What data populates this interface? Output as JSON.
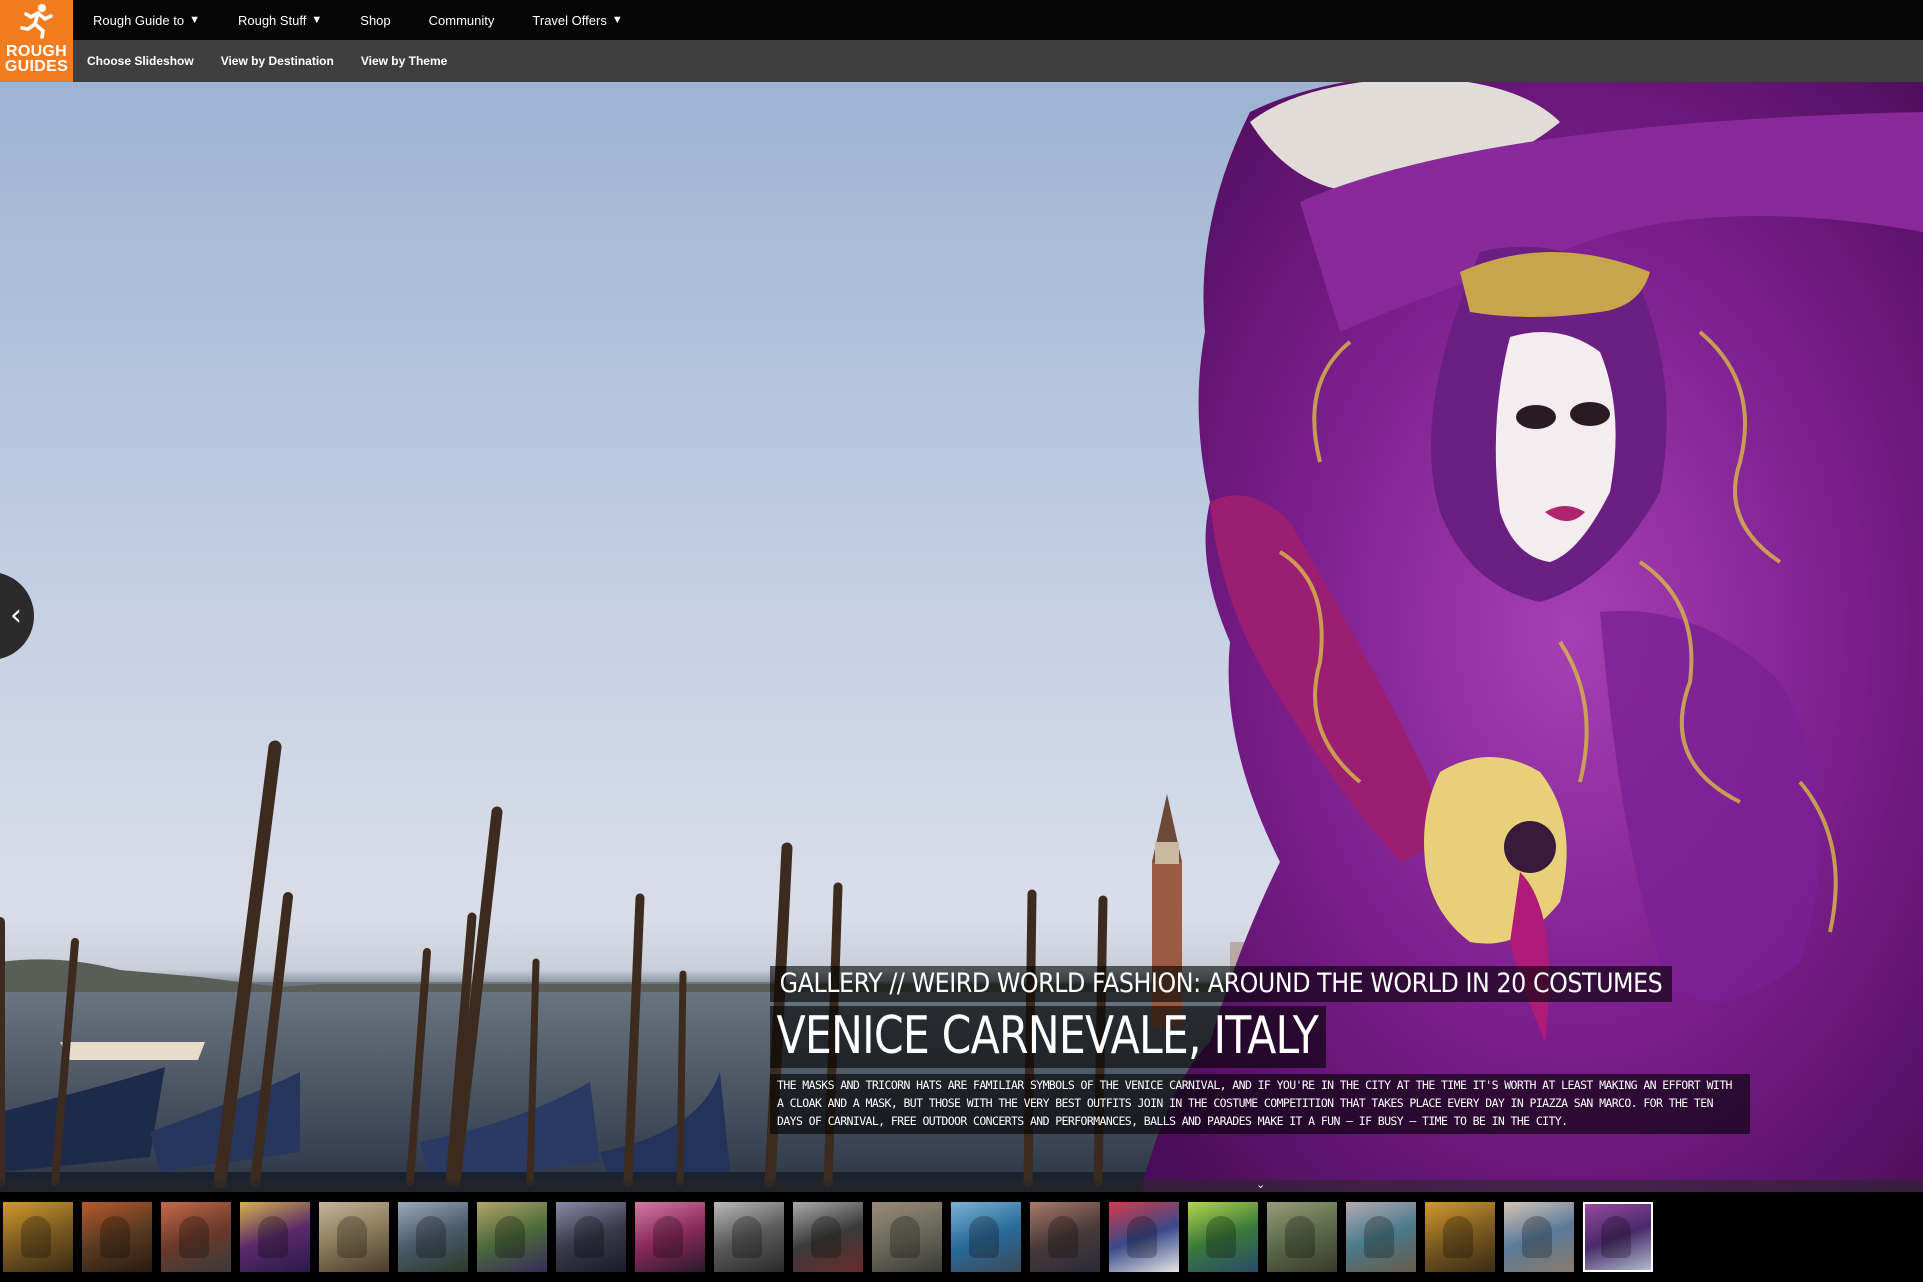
{
  "logo": {
    "line1": "ROUGH",
    "line2": "GUIDES",
    "brand_color": "#f47c20",
    "icon": "running-figure-icon"
  },
  "topnav": {
    "items": [
      {
        "label": "Rough Guide to",
        "has_dropdown": true
      },
      {
        "label": "Rough Stuff",
        "has_dropdown": true
      },
      {
        "label": "Shop",
        "has_dropdown": false
      },
      {
        "label": "Community",
        "has_dropdown": false
      },
      {
        "label": "Travel Offers",
        "has_dropdown": true
      }
    ],
    "caret": "▼"
  },
  "subnav": {
    "items": [
      {
        "label": "Choose Slideshow"
      },
      {
        "label": "View by Destination"
      },
      {
        "label": "View by Theme"
      }
    ]
  },
  "slideshow": {
    "prev_arrow": "‹",
    "gallery_title": "GALLERY // WEIRD WORLD FASHION: AROUND THE WORLD IN 20 COSTUMES",
    "slide_title": "VENICE CARNEVALE, ITALY",
    "description": "The masks and tricorn hats are familiar symbols of the Venice Carnival, and if you're in the city at the time it's worth at least making an effort with a cloak and a mask, but those with the very best outfits join in the costume competition that takes place every day in Piazza San Marco. For the ten days of carnival, free outdoor concerts and performances, balls and parades make it a fun – if busy – time to be in the city.",
    "expand_icon": "⌄"
  },
  "thumbnails": [
    {
      "colors": [
        "#7a5a22",
        "#d39a2a",
        "#3b2a14"
      ]
    },
    {
      "colors": [
        "#5a3b22",
        "#b85a2a",
        "#2a1a10"
      ]
    },
    {
      "colors": [
        "#6a3a2a",
        "#c76a4a",
        "#3a3a3a"
      ]
    },
    {
      "colors": [
        "#5a2a6a",
        "#d4b24a",
        "#2a1a4a"
      ]
    },
    {
      "colors": [
        "#8a7a5a",
        "#c4b49a",
        "#4a3a2a"
      ]
    },
    {
      "colors": [
        "#4a5a6a",
        "#9aaaba",
        "#2a3a2a"
      ]
    },
    {
      "colors": [
        "#4a6a3a",
        "#b4a46a",
        "#3a2a5a"
      ]
    },
    {
      "colors": [
        "#3a3a4a",
        "#8a8aaa",
        "#1a1a2a"
      ]
    },
    {
      "colors": [
        "#8a2a5a",
        "#d47aa4",
        "#2a1a2a"
      ]
    },
    {
      "colors": [
        "#5a5a5a",
        "#bababa",
        "#2a2a2a"
      ]
    },
    {
      "colors": [
        "#3a3a3a",
        "#aaaaaa",
        "#6a2a2a"
      ]
    },
    {
      "colors": [
        "#6a6a5a",
        "#9a8a7a",
        "#3a3a3a"
      ]
    },
    {
      "colors": [
        "#2a6a9a",
        "#7ab4d4",
        "#3a4a5a"
      ]
    },
    {
      "colors": [
        "#4a3a3a",
        "#aa7a6a",
        "#2a2a3a"
      ]
    },
    {
      "colors": [
        "#3a4a8a",
        "#d43a4a",
        "#e4e4e4"
      ]
    },
    {
      "colors": [
        "#3a7a3a",
        "#b4d44a",
        "#2a4a6a"
      ]
    },
    {
      "colors": [
        "#5a6a4a",
        "#9a9a7a",
        "#3a3a2a"
      ]
    },
    {
      "colors": [
        "#4a7a8a",
        "#b4aab4",
        "#6a5a4a"
      ]
    },
    {
      "colors": [
        "#7a5a22",
        "#d39a2a",
        "#3b2a14"
      ]
    },
    {
      "colors": [
        "#5a7a9a",
        "#d4c4b4",
        "#8a7a6a"
      ]
    },
    {
      "colors": [
        "#4a2a6a",
        "#9a4aa4",
        "#b4c4d4"
      ]
    }
  ],
  "active_thumbnail_index": 20,
  "colors": {
    "topbar": "#050505",
    "subbar": "#3f3f3f",
    "caption_bg": "rgba(0,0,0,0.6)"
  }
}
